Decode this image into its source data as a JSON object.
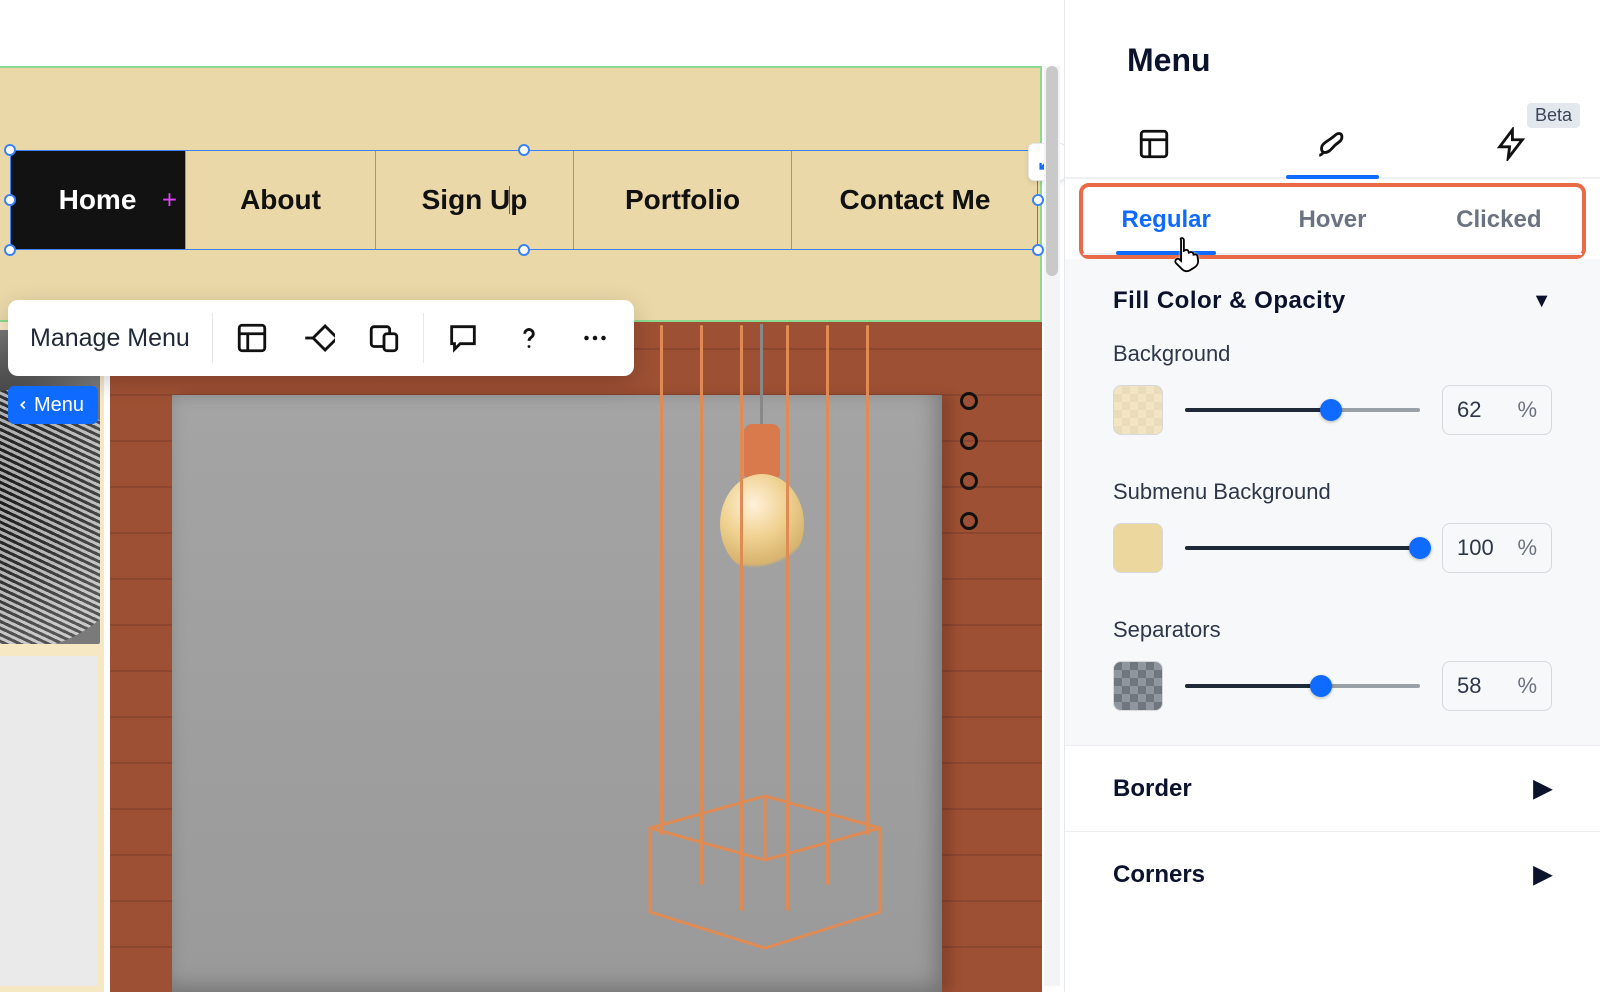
{
  "canvas": {
    "nav": {
      "items": [
        {
          "label": "Home",
          "active": true,
          "has_submenu": true
        },
        {
          "label": "About"
        },
        {
          "label": "Sign Up"
        },
        {
          "label": "Portfolio"
        },
        {
          "label": "Contact Me"
        }
      ]
    },
    "toolbar": {
      "manage_label": "Manage Menu"
    },
    "breadcrumb": {
      "label": "Menu"
    }
  },
  "panel": {
    "title": "Menu",
    "beta_label": "Beta",
    "state_tabs": {
      "regular": "Regular",
      "hover": "Hover",
      "clicked": "Clicked"
    },
    "fill_section": {
      "title": "Fill Color & Opacity",
      "background_label": "Background",
      "background_value": "62",
      "background_unit": "%",
      "submenu_label": "Submenu Background",
      "submenu_value": "100",
      "submenu_unit": "%",
      "separators_label": "Separators",
      "separators_value": "58",
      "separators_unit": "%"
    },
    "border_section": {
      "title": "Border"
    },
    "corners_section": {
      "title": "Corners"
    }
  }
}
